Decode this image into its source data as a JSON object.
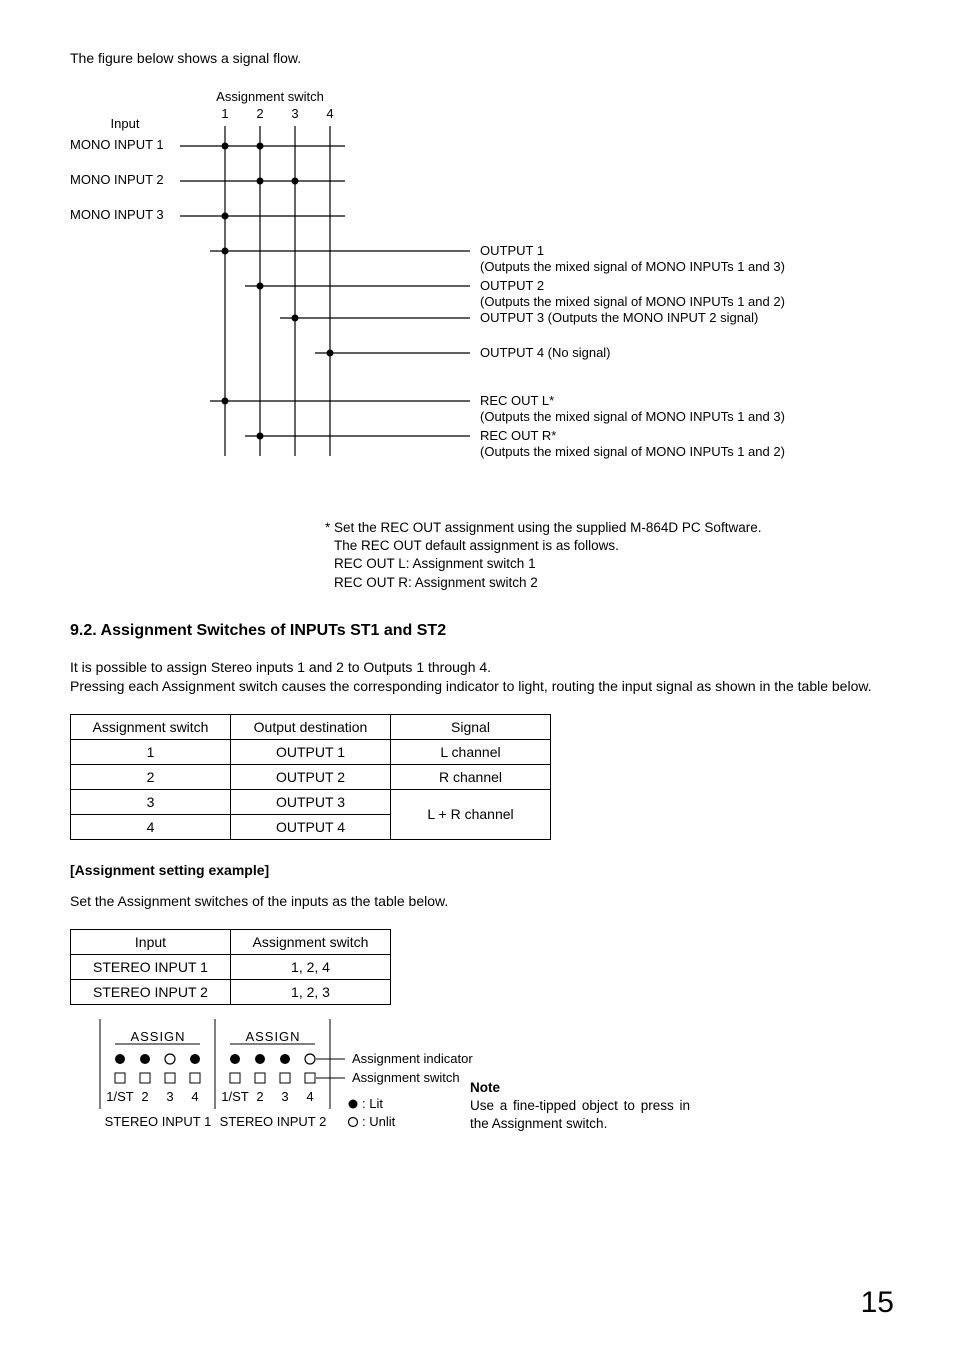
{
  "intro": "The figure below shows a signal flow.",
  "diagram": {
    "title_switch": "Assignment switch",
    "cols": [
      "1",
      "2",
      "3",
      "4"
    ],
    "input_header": "Input",
    "inputs": [
      "MONO INPUT 1",
      "MONO INPUT 2",
      "MONO INPUT 3"
    ],
    "outputs": [
      {
        "line1": "OUTPUT 1",
        "line2": "(Outputs the mixed signal of MONO INPUTs 1 and 3)"
      },
      {
        "line1": "OUTPUT 2",
        "line2": "(Outputs the mixed signal of MONO INPUTs 1 and 2)"
      },
      {
        "line1": "OUTPUT 3 (Outputs the MONO INPUT 2 signal)",
        "line2": ""
      },
      {
        "line1": "OUTPUT 4 (No signal)",
        "line2": ""
      },
      {
        "line1": "REC OUT L*",
        "line2": "(Outputs the mixed signal of MONO INPUTs 1 and 3)"
      },
      {
        "line1": "REC OUT R*",
        "line2": "(Outputs the mixed signal of MONO INPUTs 1 and 2)"
      }
    ],
    "footnote": [
      "* Set the REC OUT assignment using the supplied M-864D PC Software.",
      "The REC OUT default assignment is as follows.",
      "REC OUT L:  Assignment switch 1",
      "REC OUT R: Assignment switch 2"
    ]
  },
  "section_title": "9.2. Assignment Switches of INPUTs ST1 and ST2",
  "section_para": "It is possible to assign Stereo inputs 1 and 2 to Outputs 1 through 4.\nPressing each Assignment switch causes the corresponding indicator to light, routing the input signal as shown in the table below.",
  "table1": {
    "headers": [
      "Assignment switch",
      "Output destination",
      "Signal"
    ],
    "rows": [
      [
        "1",
        "OUTPUT 1",
        "L channel"
      ],
      [
        "2",
        "OUTPUT 2",
        "R channel"
      ],
      [
        "3",
        "OUTPUT 3",
        "L + R channel"
      ],
      [
        "4",
        "OUTPUT 4",
        "L + R channel"
      ]
    ]
  },
  "example_heading": "[Assignment setting example]",
  "example_para": "Set the Assignment switches of the inputs as the table below.",
  "table2": {
    "headers": [
      "Input",
      "Assignment switch"
    ],
    "rows": [
      [
        "STEREO INPUT 1",
        "1, 2, 4"
      ],
      [
        "STEREO INPUT 2",
        "1, 2, 3"
      ]
    ]
  },
  "assign_vis": {
    "group_label": "ASSIGN",
    "col_labels": [
      "1/ST",
      "2",
      "3",
      "4"
    ],
    "input1": {
      "caption": "STEREO INPUT 1",
      "lit": [
        true,
        true,
        false,
        true
      ]
    },
    "input2": {
      "caption": "STEREO INPUT 2",
      "lit": [
        true,
        true,
        true,
        false
      ]
    },
    "annot_indicator": "Assignment indicator",
    "annot_switch": "Assignment switch",
    "legend_lit": ": Lit",
    "legend_unlit": ": Unlit"
  },
  "note": {
    "title": "Note",
    "body": "Use a fine-tipped object to press in the Assignment switch."
  },
  "page_number": "15"
}
